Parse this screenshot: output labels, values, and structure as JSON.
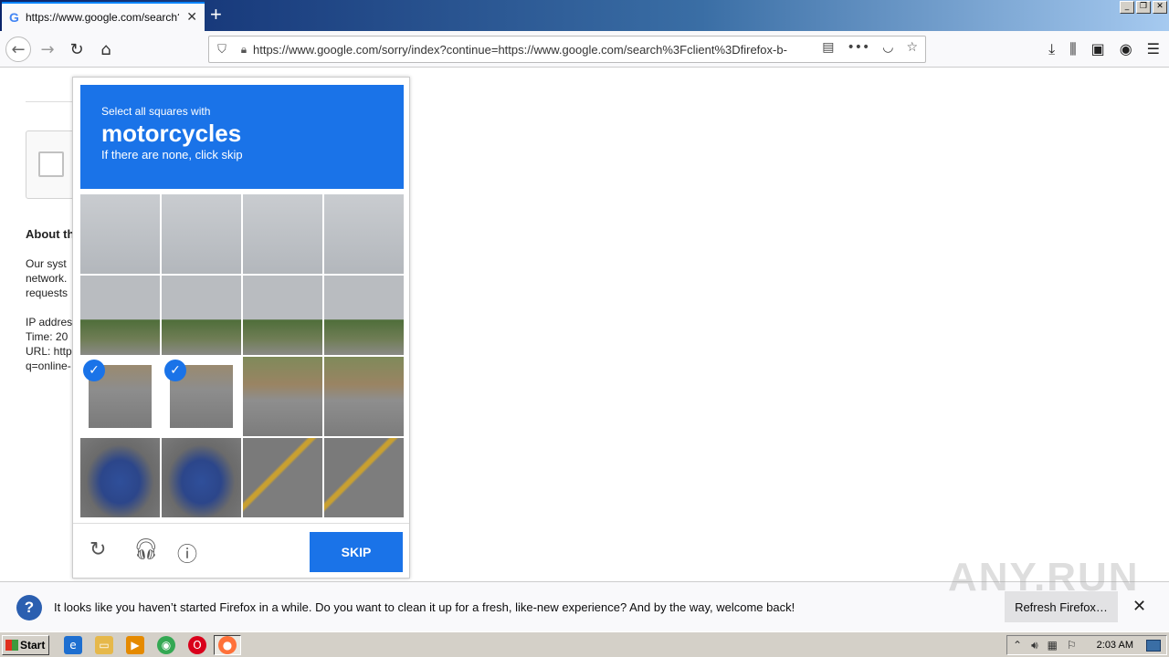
{
  "browser": {
    "tab_title": "https://www.google.com/search?c",
    "tab_favicon": "G",
    "url": "https://www.google.com/sorry/index?continue=https://www.google.com/search%3Fclient%3Dfirefox-b-"
  },
  "page": {
    "about_heading": "About th",
    "paragraph_lines": [
      "Our syst",
      "network.",
      "requests"
    ],
    "info_lines": [
      "IP addres",
      "Time: 20",
      "URL: http",
      "q=online-"
    ]
  },
  "captcha": {
    "instruction_small": "Select all squares with",
    "instruction_big": "motorcycles",
    "instruction_sub": "If there are none, click skip",
    "skip_label": "SKIP",
    "selected_tiles": [
      8,
      9
    ]
  },
  "notification": {
    "message": "It looks like you haven’t started Firefox in a while. Do you want to clean it up for a fresh, like-new experience? And by the way, welcome back!",
    "button_label": "Refresh Firefox…"
  },
  "watermark": "ANY.RUN",
  "taskbar": {
    "start_label": "Start",
    "clock": "2:03 AM"
  }
}
